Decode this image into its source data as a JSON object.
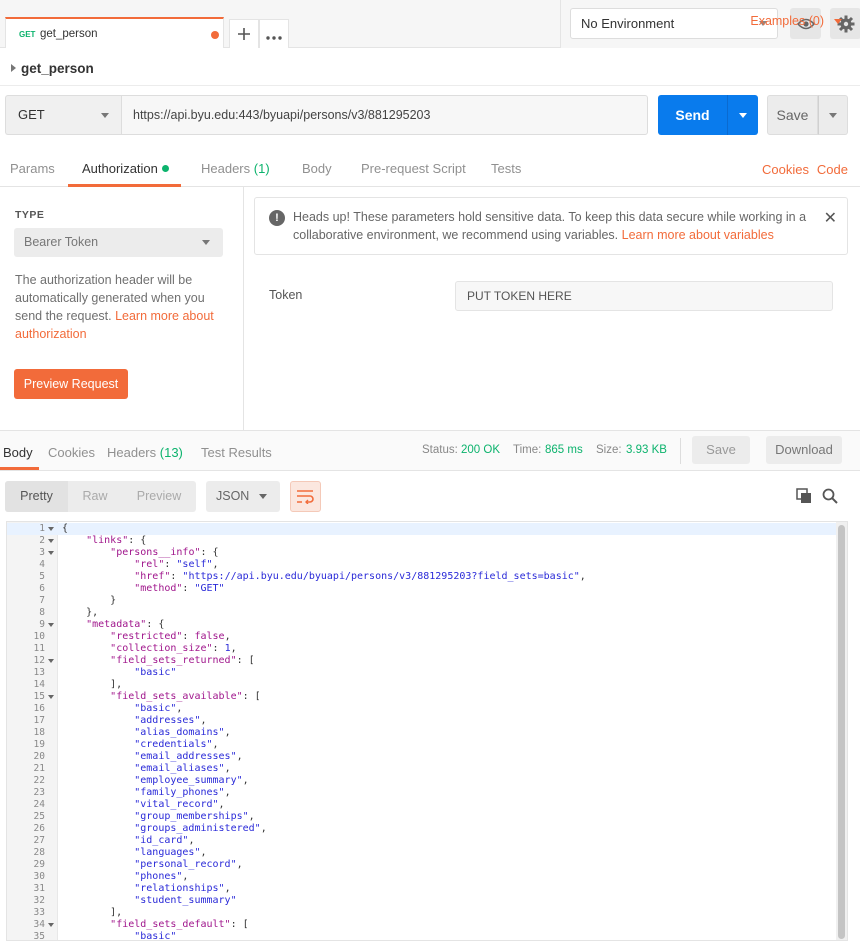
{
  "tabbar": {
    "tab_method": "GET",
    "tab_name": "get_person",
    "add_icon": "plus-icon",
    "more_icon": "ellipsis-icon"
  },
  "env": {
    "selected": "No Environment",
    "eye_icon": "eye-icon",
    "settings_icon": "gear-icon"
  },
  "request": {
    "name": "get_person",
    "examples": "Examples (0)",
    "method": "GET",
    "url": "https://api.byu.edu:443/byuapi/persons/v3/881295203",
    "send": "Send",
    "save": "Save"
  },
  "req_tabs": {
    "params": "Params",
    "authorization": "Authorization",
    "headers": "Headers",
    "headers_count": "(1)",
    "body": "Body",
    "prerequest": "Pre-request Script",
    "tests": "Tests",
    "cookies": "Cookies",
    "code": "Code"
  },
  "auth": {
    "type_label": "TYPE",
    "type_value": "Bearer Token",
    "desc_pre": "The authorization header will be automatically generated when you send the request. ",
    "desc_link": "Learn more about authorization",
    "preview": "Preview Request",
    "alert_text": "Heads up! These parameters hold sensitive data. To keep this data secure while working in a collaborative environment, we recommend using variables. ",
    "alert_link": "Learn more about variables",
    "token_label": "Token",
    "token_value": "PUT TOKEN HERE"
  },
  "response": {
    "body": "Body",
    "cookies": "Cookies",
    "headers": "Headers",
    "headers_count": "(13)",
    "test_results": "Test Results",
    "status_label": "Status:",
    "status_value": "200 OK",
    "time_label": "Time:",
    "time_value": "865 ms",
    "size_label": "Size:",
    "size_value": "3.93 KB",
    "save": "Save",
    "download": "Download",
    "view_pretty": "Pretty",
    "view_raw": "Raw",
    "view_preview": "Preview",
    "format": "JSON"
  },
  "code_lines": [
    {
      "n": "1",
      "fold": true,
      "t": "{"
    },
    {
      "n": "2",
      "fold": true,
      "t": "    \"links\": {"
    },
    {
      "n": "3",
      "fold": true,
      "t": "        \"persons__info\": {"
    },
    {
      "n": "4",
      "fold": false,
      "t": "            \"rel\": \"self\","
    },
    {
      "n": "5",
      "fold": false,
      "t": "            \"href\": \"https://api.byu.edu/byuapi/persons/v3/881295203?field_sets=basic\","
    },
    {
      "n": "6",
      "fold": false,
      "t": "            \"method\": \"GET\""
    },
    {
      "n": "7",
      "fold": false,
      "t": "        }"
    },
    {
      "n": "8",
      "fold": false,
      "t": "    },"
    },
    {
      "n": "9",
      "fold": true,
      "t": "    \"metadata\": {"
    },
    {
      "n": "10",
      "fold": false,
      "t": "        \"restricted\": false,"
    },
    {
      "n": "11",
      "fold": false,
      "t": "        \"collection_size\": 1,"
    },
    {
      "n": "12",
      "fold": true,
      "t": "        \"field_sets_returned\": ["
    },
    {
      "n": "13",
      "fold": false,
      "t": "            \"basic\""
    },
    {
      "n": "14",
      "fold": false,
      "t": "        ],"
    },
    {
      "n": "15",
      "fold": true,
      "t": "        \"field_sets_available\": ["
    },
    {
      "n": "16",
      "fold": false,
      "t": "            \"basic\","
    },
    {
      "n": "17",
      "fold": false,
      "t": "            \"addresses\","
    },
    {
      "n": "18",
      "fold": false,
      "t": "            \"alias_domains\","
    },
    {
      "n": "19",
      "fold": false,
      "t": "            \"credentials\","
    },
    {
      "n": "20",
      "fold": false,
      "t": "            \"email_addresses\","
    },
    {
      "n": "21",
      "fold": false,
      "t": "            \"email_aliases\","
    },
    {
      "n": "22",
      "fold": false,
      "t": "            \"employee_summary\","
    },
    {
      "n": "23",
      "fold": false,
      "t": "            \"family_phones\","
    },
    {
      "n": "24",
      "fold": false,
      "t": "            \"vital_record\","
    },
    {
      "n": "25",
      "fold": false,
      "t": "            \"group_memberships\","
    },
    {
      "n": "26",
      "fold": false,
      "t": "            \"groups_administered\","
    },
    {
      "n": "27",
      "fold": false,
      "t": "            \"id_card\","
    },
    {
      "n": "28",
      "fold": false,
      "t": "            \"languages\","
    },
    {
      "n": "29",
      "fold": false,
      "t": "            \"personal_record\","
    },
    {
      "n": "30",
      "fold": false,
      "t": "            \"phones\","
    },
    {
      "n": "31",
      "fold": false,
      "t": "            \"relationships\","
    },
    {
      "n": "32",
      "fold": false,
      "t": "            \"student_summary\""
    },
    {
      "n": "33",
      "fold": false,
      "t": "        ],"
    },
    {
      "n": "34",
      "fold": true,
      "t": "        \"field_sets_default\": ["
    },
    {
      "n": "35",
      "fold": false,
      "t": "            \"basic\""
    }
  ],
  "colors": {
    "accent": "#f26b3a",
    "send_blue": "#097bed",
    "ok_green": "#0cb36d"
  }
}
